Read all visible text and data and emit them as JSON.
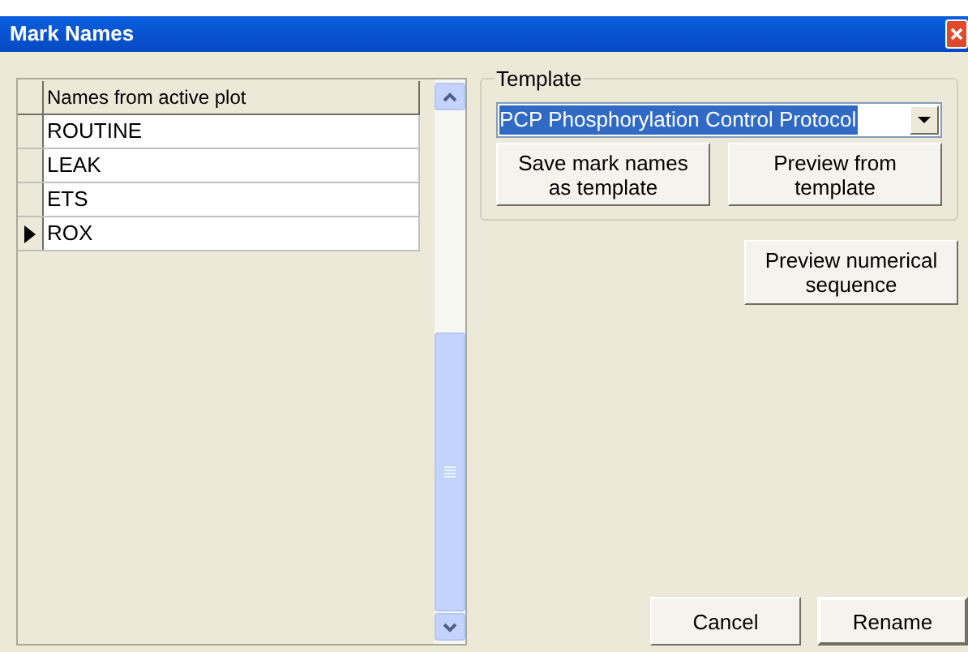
{
  "window": {
    "title": "Mark Names"
  },
  "grid": {
    "header": "Names from active plot",
    "rows": [
      {
        "name": "ROUTINE",
        "selected": false
      },
      {
        "name": "LEAK",
        "selected": false
      },
      {
        "name": "ETS",
        "selected": false
      },
      {
        "name": "ROX",
        "selected": true
      }
    ]
  },
  "template": {
    "label": "Template",
    "value": "PCP Phosphorylation Control Protocol"
  },
  "buttons": [
    {
      "label": "Save mark names as template"
    },
    {
      "label": "Preview from template"
    }
  ],
  "preview_button": {
    "label": "Preview numerical sequence"
  },
  "footer_buttons": [
    {
      "label": "Cancel",
      "default": false
    },
    {
      "label": "Rename",
      "default": true
    }
  ]
}
